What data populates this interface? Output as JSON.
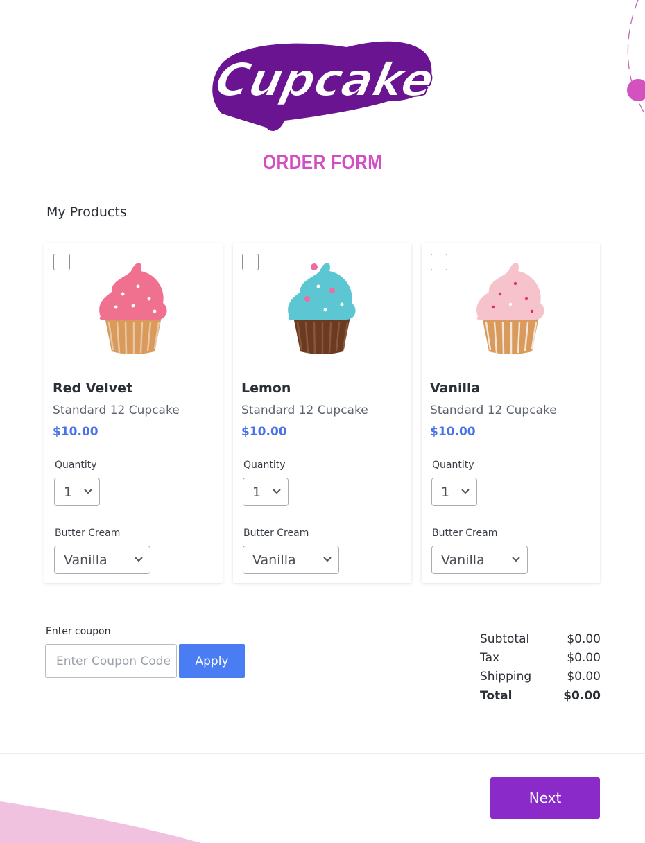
{
  "logo_text": "Cupcake",
  "form_title": "ORDER FORM",
  "section_title": "My Products",
  "products": [
    {
      "name": "Red Velvet",
      "description": "Standard 12 Cupcake",
      "price": "$10.00",
      "quantity_label": "Quantity",
      "quantity": "1",
      "cream_label": "Butter Cream",
      "cream": "Vanilla",
      "frosting_color": "#f0708f",
      "checked": false
    },
    {
      "name": "Lemon",
      "description": "Standard 12 Cupcake",
      "price": "$10.00",
      "quantity_label": "Quantity",
      "quantity": "1",
      "cream_label": "Butter Cream",
      "cream": "Vanilla",
      "frosting_color": "#5cc7d2",
      "checked": false
    },
    {
      "name": "Vanilla",
      "description": "Standard 12 Cupcake",
      "price": "$10.00",
      "quantity_label": "Quantity",
      "quantity": "1",
      "cream_label": "Butter Cream",
      "cream": "Vanilla",
      "frosting_color": "#f6c3cc",
      "checked": false
    }
  ],
  "coupon": {
    "label": "Enter coupon",
    "placeholder": "Enter Coupon Code",
    "value": "",
    "apply_label": "Apply"
  },
  "summary": {
    "subtotal_label": "Subtotal",
    "subtotal": "$0.00",
    "tax_label": "Tax",
    "tax": "$0.00",
    "shipping_label": "Shipping",
    "shipping": "$0.00",
    "total_label": "Total",
    "total": "$0.00"
  },
  "next_label": "Next",
  "colors": {
    "brand_purple": "#8a2ac9",
    "title_pink": "#d24ec2",
    "price_blue": "#4a72e8",
    "apply_blue": "#4a7cf4"
  }
}
